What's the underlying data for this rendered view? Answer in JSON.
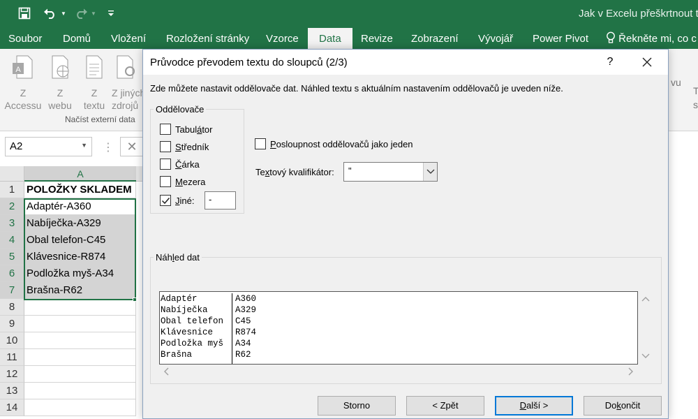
{
  "window": {
    "title": "Jak v Excelu přeškrtnout te"
  },
  "ribbon_tabs": [
    {
      "label": "Soubor"
    },
    {
      "label": "Domů"
    },
    {
      "label": "Vložení"
    },
    {
      "label": "Rozložení stránky"
    },
    {
      "label": "Vzorce"
    },
    {
      "label": "Data",
      "active": true
    },
    {
      "label": "Revize"
    },
    {
      "label": "Zobrazení"
    },
    {
      "label": "Vývojář"
    },
    {
      "label": "Power Pivot"
    }
  ],
  "tell_me": {
    "label": "Řekněte mi, co c"
  },
  "ribbon": {
    "buttons": [
      {
        "line1": "Z",
        "line2": "Accessu",
        "icon": "access-db-icon"
      },
      {
        "line1": "Z",
        "line2": "webu",
        "icon": "web-page-icon"
      },
      {
        "line1": "Z",
        "line2": "textu",
        "icon": "text-file-icon"
      },
      {
        "line1": "Z jiných",
        "line2": "zdrojů",
        "icon": "other-sources-icon"
      }
    ],
    "group_label": "Načíst externí data",
    "right_fragments": [
      "vu",
      "T",
      "s"
    ]
  },
  "name_box": {
    "value": "A2"
  },
  "sheet": {
    "column_header": "A",
    "rows": [
      {
        "num": "1",
        "value": "POLOŽKY SKLADEM"
      },
      {
        "num": "2",
        "value": "Adaptér-A360"
      },
      {
        "num": "3",
        "value": "Nabíječka-A329"
      },
      {
        "num": "4",
        "value": "Obal telefon-C45"
      },
      {
        "num": "5",
        "value": "Klávesnice-R874"
      },
      {
        "num": "6",
        "value": "Podložka myš-A34"
      },
      {
        "num": "7",
        "value": "Brašna-R62"
      },
      {
        "num": "8",
        "value": ""
      },
      {
        "num": "9",
        "value": ""
      },
      {
        "num": "10",
        "value": ""
      },
      {
        "num": "11",
        "value": ""
      },
      {
        "num": "12",
        "value": ""
      },
      {
        "num": "13",
        "value": ""
      },
      {
        "num": "14",
        "value": ""
      }
    ]
  },
  "dialog": {
    "title": "Průvodce převodem textu do sloupců (2/3)",
    "help": "?",
    "description": "Zde můžete nastavit oddělovače dat. Náhled textu s aktuálním nastavením oddělovačů je uveden níže.",
    "delimiters": {
      "label": "Oddělovače",
      "tab": {
        "pre": "Tabul",
        "u": "á",
        "post": "tor",
        "checked": false
      },
      "semicolon": {
        "pre": "",
        "u": "S",
        "post": "tředník",
        "checked": false
      },
      "comma": {
        "pre": "",
        "u": "Č",
        "post": "árka",
        "checked": false
      },
      "space": {
        "pre": "",
        "u": "M",
        "post": "ezera",
        "checked": false
      },
      "other": {
        "pre": "",
        "u": "J",
        "post": "iné:",
        "checked": true,
        "value": "-"
      }
    },
    "consecutive": {
      "pre": "",
      "u": "P",
      "post": "osloupnost oddělovačů jako jeden",
      "checked": false
    },
    "qualifier": {
      "pre": "Te",
      "u": "x",
      "post": "tový kvalifikátor:",
      "value": "\""
    },
    "preview": {
      "label_pre": "Náh",
      "label_u": "l",
      "label_post": "ed dat",
      "col1": [
        "Adaptér",
        "Nabíječka",
        "Obal telefon",
        "Klávesnice",
        "Podložka myš",
        "Brašna"
      ],
      "col2": [
        "A360",
        "A329",
        "C45",
        "R874",
        "A34",
        "R62"
      ]
    },
    "buttons": {
      "cancel": "Storno",
      "back": "< Zpět",
      "next_u": "D",
      "next_post": "alší >",
      "finish_pre": "Do",
      "finish_u": "k",
      "finish_post": "ončit"
    }
  }
}
